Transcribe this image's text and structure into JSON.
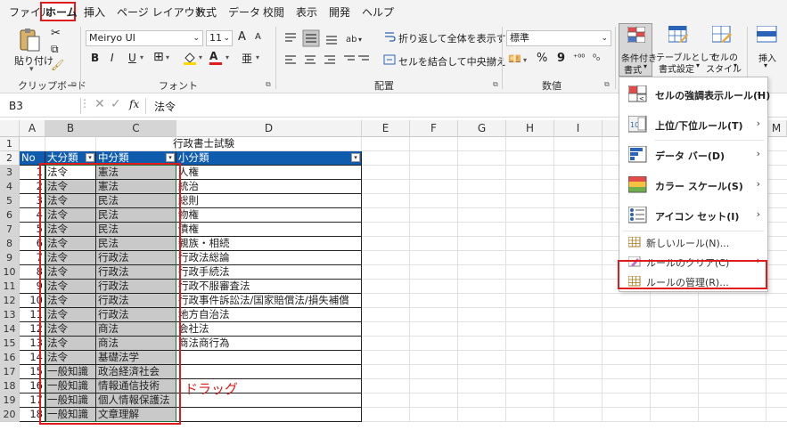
{
  "tabs": [
    "ファイル",
    "ホーム",
    "挿入",
    "ページ レイアウト",
    "数式",
    "データ",
    "校閲",
    "表示",
    "開発",
    "ヘルプ"
  ],
  "ribbon": {
    "clipboard": {
      "paste_label": "貼り付け",
      "group_label": "クリップボード"
    },
    "font": {
      "font_name": "Meiryo UI",
      "font_size": "11",
      "group_label": "フォント",
      "bold": "B",
      "italic": "I",
      "underline": "U",
      "grow": "A",
      "shrink": "A"
    },
    "alignment": {
      "wrap_label": "折り返して全体を表示する",
      "merge_label": "セルを結合して中央揃え",
      "group_label": "配置"
    },
    "number": {
      "format": "標準",
      "group_label": "数値",
      "percent": "%",
      "comma": "9"
    },
    "styles": {
      "cond_format_label_1": "条件付き",
      "cond_format_label_2": "書式",
      "table_label_1": "テーブルとして",
      "table_label_2": "書式設定",
      "cell_style_label_1": "セルの",
      "cell_style_label_2": "スタイル"
    },
    "cells": {
      "insert_label": "挿入"
    }
  },
  "formula_bar": {
    "name_box": "B3",
    "fx": "fx",
    "content": "法令"
  },
  "columns": [
    "A",
    "B",
    "C",
    "D",
    "E",
    "F",
    "G",
    "H",
    "I",
    "J",
    "K",
    "L",
    "M"
  ],
  "sheet": {
    "title": "行政書士試験",
    "headers": [
      "No",
      "大分類",
      "中分類",
      "小分類"
    ],
    "rows": [
      [
        "1",
        "法令",
        "憲法",
        "人権"
      ],
      [
        "2",
        "法令",
        "憲法",
        "統治"
      ],
      [
        "3",
        "法令",
        "民法",
        "総則"
      ],
      [
        "4",
        "法令",
        "民法",
        "物権"
      ],
      [
        "5",
        "法令",
        "民法",
        "債権"
      ],
      [
        "6",
        "法令",
        "民法",
        "親族・相続"
      ],
      [
        "7",
        "法令",
        "行政法",
        "行政法総論"
      ],
      [
        "8",
        "法令",
        "行政法",
        "行政手続法"
      ],
      [
        "9",
        "法令",
        "行政法",
        "行政不服審査法"
      ],
      [
        "10",
        "法令",
        "行政法",
        "行政事件訴訟法/国家賠償法/損失補償"
      ],
      [
        "11",
        "法令",
        "行政法",
        "地方自治法"
      ],
      [
        "12",
        "法令",
        "商法",
        "会社法"
      ],
      [
        "13",
        "法令",
        "商法",
        "商法商行為"
      ],
      [
        "14",
        "法令",
        "基礎法学",
        ""
      ],
      [
        "15",
        "一般知識",
        "政治経済社会",
        ""
      ],
      [
        "16",
        "一般知識",
        "情報通信技術",
        ""
      ],
      [
        "17",
        "一般知識",
        "個人情報保護法",
        ""
      ],
      [
        "18",
        "一般知識",
        "文章理解",
        ""
      ]
    ]
  },
  "annotation": {
    "drag_label": "ドラッグ"
  },
  "cf_menu": {
    "items": [
      {
        "label": "セルの強調表示ルール(H)",
        "icon": "highlight-rules-icon"
      },
      {
        "label": "上位/下位ルール(T)",
        "icon": "top-bottom-rules-icon"
      },
      {
        "label": "データ バー(D)",
        "icon": "data-bars-icon"
      },
      {
        "label": "カラー スケール(S)",
        "icon": "color-scales-icon"
      },
      {
        "label": "アイコン セット(I)",
        "icon": "icon-sets-icon"
      }
    ],
    "small_items": [
      {
        "label": "新しいルール(N)...",
        "icon": "new-rule-icon"
      },
      {
        "label": "ルールのクリア(C)",
        "icon": "clear-rules-icon"
      },
      {
        "label": "ルールの管理(R)...",
        "icon": "manage-rules-icon"
      }
    ]
  },
  "colors": {
    "accent": "#0f5cae",
    "highlight_red": "#e01b1b",
    "selection": "#c9c9c9",
    "ribbon_bg": "#f3f3f3"
  }
}
